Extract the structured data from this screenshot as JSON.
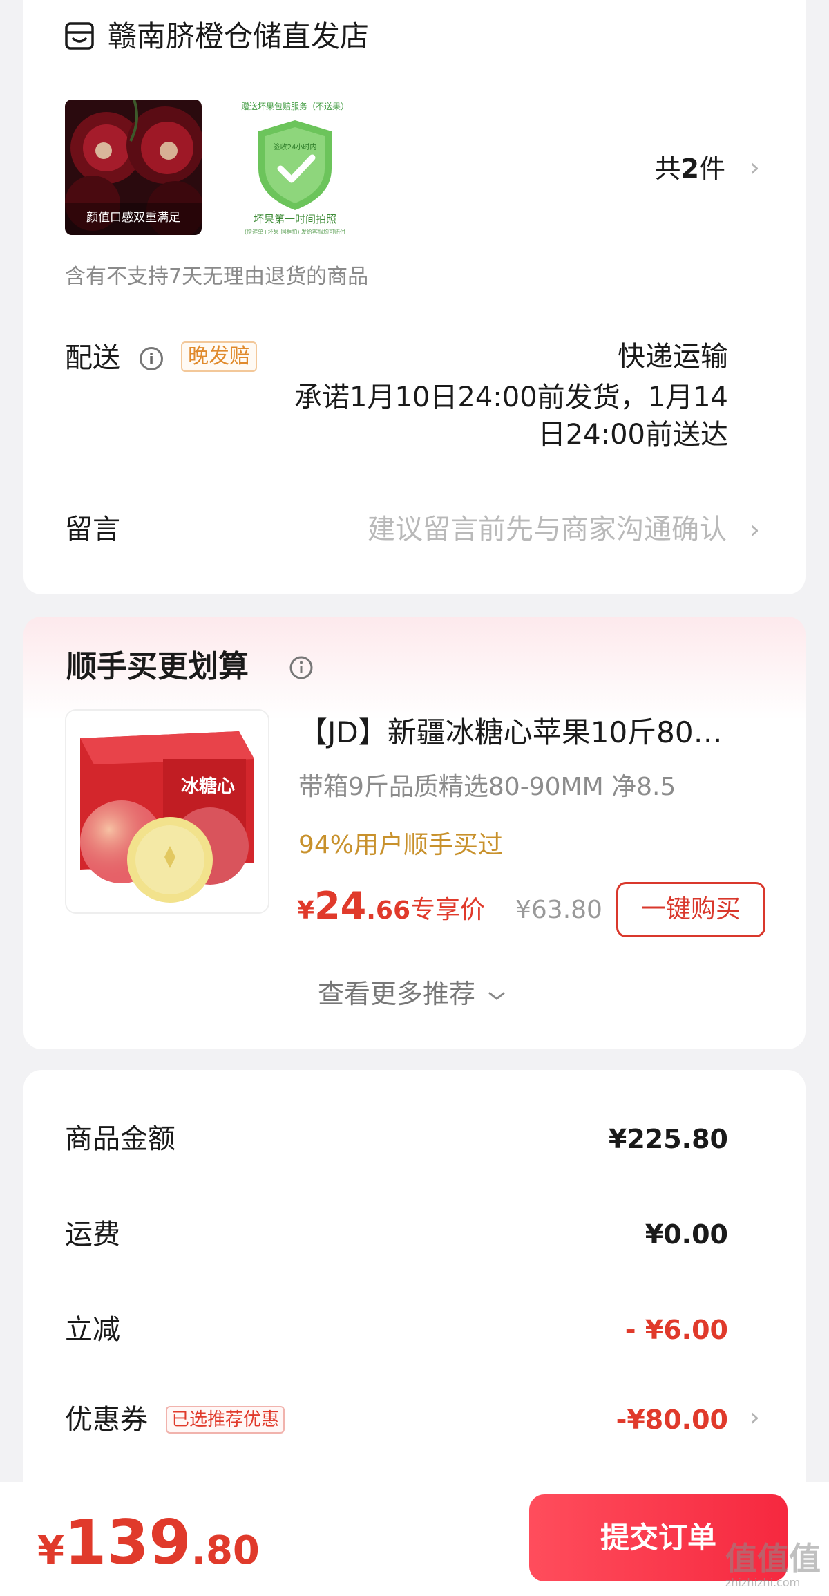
{
  "store": {
    "name": "赣南脐橙仓储直发店",
    "item_count_prefix": "共",
    "item_count": "2",
    "item_count_suffix": "件",
    "chevron": "›",
    "return_notice": "含有不支持7天无理由退货的商品",
    "thumb1_caption": "颜值口感双重满足",
    "thumb2_top": "赠送坏果包赔服务（不送果）",
    "thumb2_shield": "签收24小时内",
    "thumb2_bottom": "坏果第一时间拍照",
    "thumb2_small": "(快递单+坏果 同框拍) 发给客服均可赔付"
  },
  "delivery": {
    "label": "配送",
    "info_icon": "info-icon",
    "badge": "晚发赔",
    "method": "快递运输",
    "promise": "承诺1月10日24:00前发货，1月14日24:00前送达"
  },
  "message": {
    "label": "留言",
    "placeholder": "建议留言前先与商家沟通确认"
  },
  "promo": {
    "title": "顺手买更划算",
    "product_name": "【JD】新疆冰糖心苹果10斤80…",
    "box_text": "冰糖心",
    "spec": "带箱9斤品质精选80-90MM 净8.5",
    "social_proof": "94%用户顺手买过",
    "price_currency": "¥",
    "price_int": "24",
    "price_dec": ".66",
    "exclusive_label": "专享价",
    "original_price": "¥63.80",
    "buy_button": "一键购买",
    "more": "查看更多推荐",
    "more_icon": "chevron-down-icon"
  },
  "summary": {
    "rows": [
      {
        "label": "商品金额",
        "value": "¥225.80",
        "color": "#1a1a1a"
      },
      {
        "label": "运费",
        "value": "¥0.00",
        "color": "#1a1a1a"
      },
      {
        "label": "立减",
        "value": "- ¥6.00",
        "color": "#e03a2b"
      },
      {
        "label": "优惠券",
        "value": "-¥80.00",
        "color": "#e03a2b",
        "badge": "已选推荐优惠"
      }
    ]
  },
  "footer": {
    "currency": "¥",
    "total_int": "139",
    "total_dec": ".80",
    "submit": "提交订单",
    "watermark": "值值值",
    "watermark_sub": "zhizhizhi.com"
  },
  "colors": {
    "accent_red": "#e03a2b",
    "button_gradient_start": "#ff4d5c",
    "button_gradient_end": "#f6283f",
    "social_gold": "#c8912c"
  }
}
